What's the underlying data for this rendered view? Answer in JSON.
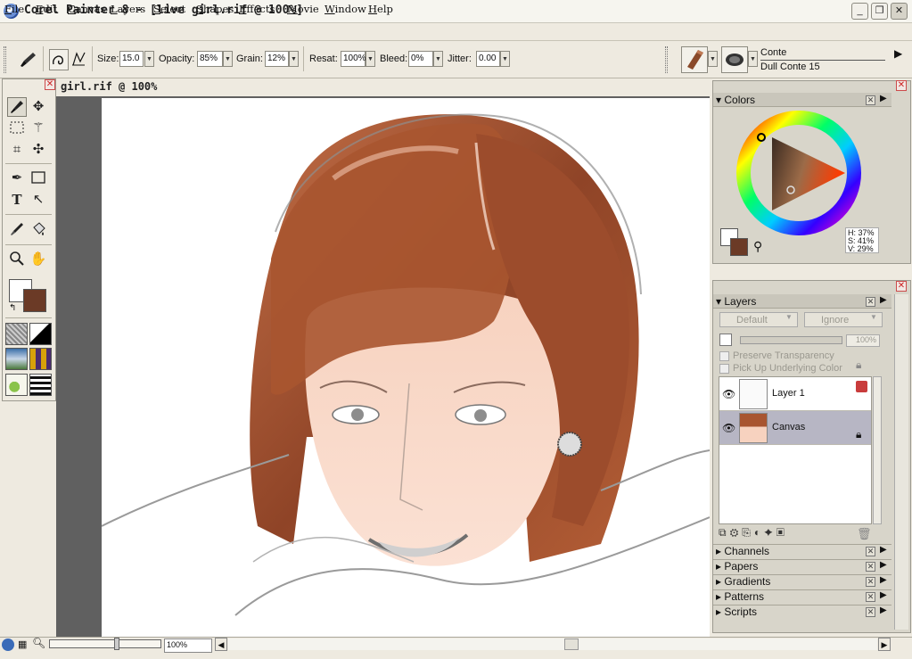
{
  "window": {
    "title": "Corel Painter 8 - [live girl.rif @ 100%]",
    "buttons": {
      "minimize": "_",
      "restore": "❐",
      "close": "✕"
    }
  },
  "menu": [
    {
      "label": "File",
      "u": "F",
      "rest": "ile"
    },
    {
      "label": "Edit",
      "u": "E",
      "rest": "dit"
    },
    {
      "label": "Canvas",
      "u": "C",
      "rest": "anvas"
    },
    {
      "label": "Layers",
      "u": "L",
      "rest": "ayers"
    },
    {
      "label": "Select",
      "u": "S",
      "rest": "elect"
    },
    {
      "label": "Shapes",
      "u": "S",
      "rest": "hapes"
    },
    {
      "label": "Effects",
      "u": "E",
      "rest": "ffects"
    },
    {
      "label": "Movie",
      "u": "M",
      "rest": "ovie"
    },
    {
      "label": "Window",
      "u": "W",
      "rest": "indow"
    },
    {
      "label": "Help",
      "u": "H",
      "rest": "elp"
    }
  ],
  "property_bar": {
    "size_label": "Size:",
    "size_value": "15.0",
    "opacity_label": "Opacity:",
    "opacity_value": "85%",
    "grain_label": "Grain:",
    "grain_value": "12%",
    "resat_label": "Resat:",
    "resat_value": "100%",
    "bleed_label": "Bleed:",
    "bleed_value": "0%",
    "jitter_label": "Jitter:",
    "jitter_value": "0.00",
    "brush_category": "Conte",
    "brush_variant": "Dull Conte 15"
  },
  "document": {
    "title": "girl.rif @ 100%",
    "zoom": "100%"
  },
  "colors_panel": {
    "title": "Colors",
    "hsv": {
      "h": "H: 37%",
      "s": "S: 41%",
      "v": "V: 29%"
    },
    "main_color": "#6b3a26",
    "secondary_color": "#ffffff"
  },
  "layers_panel": {
    "title": "Layers",
    "composite_method": "Default",
    "depth_method": "Ignore",
    "opacity": "100%",
    "preserve_transparency": "Preserve Transparency",
    "pick_up_underlying": "Pick Up Underlying Color",
    "layers": [
      {
        "name": "Layer 1",
        "selected": false
      },
      {
        "name": "Canvas",
        "selected": true
      }
    ]
  },
  "collapsed_panels": [
    "Channels",
    "Papers",
    "Gradients",
    "Patterns",
    "Scripts"
  ],
  "icons": [
    "brush-tool-icon",
    "layer-adjuster-icon",
    "rectangle-select-icon",
    "magic-wand-icon",
    "crop-icon",
    "lasso-icon",
    "pen-icon",
    "rectangle-shape-icon",
    "text-icon",
    "shape-selection-icon",
    "dropper-icon",
    "paint-bucket-icon",
    "magnifier-icon",
    "grabber-icon",
    "eye-icon",
    "lock-icon",
    "trash-icon"
  ]
}
